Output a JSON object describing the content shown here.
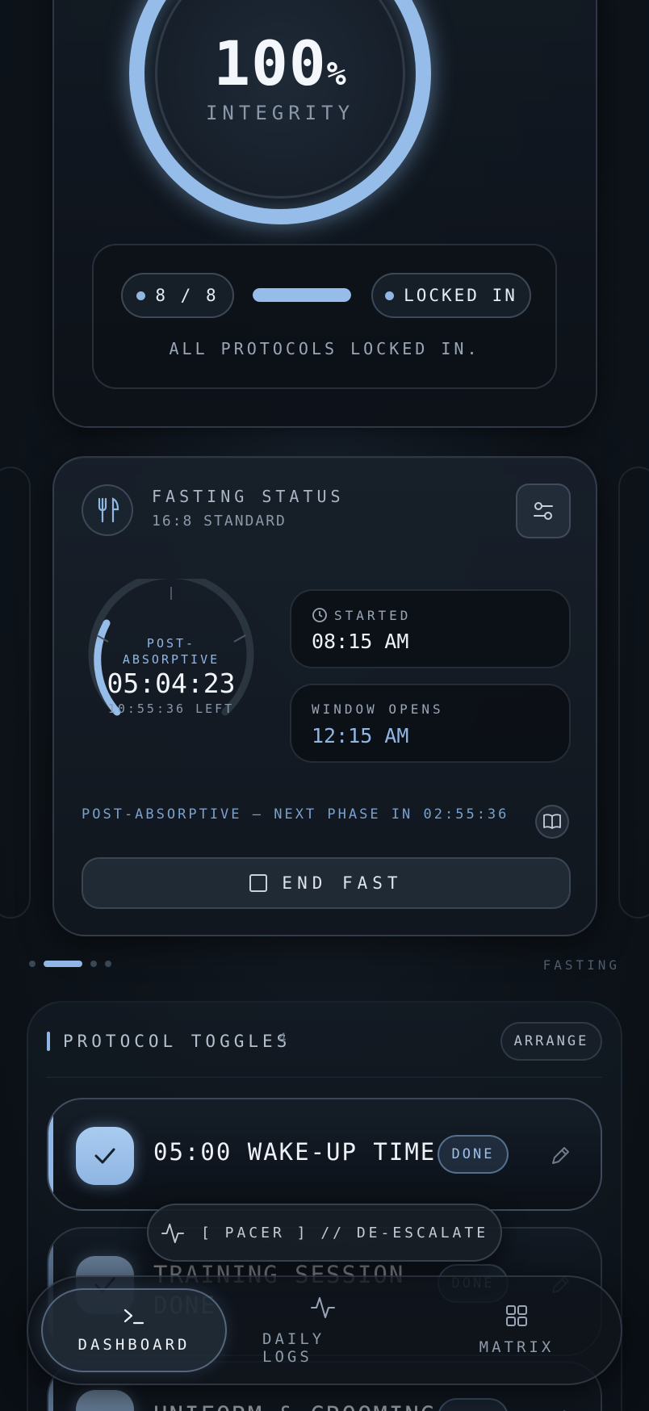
{
  "integrity": {
    "value": "100",
    "unit": "%",
    "label": "INTEGRITY",
    "count": "8 / 8",
    "progress": 1.0,
    "status": "LOCKED IN",
    "message": "ALL PROTOCOLS LOCKED IN."
  },
  "fasting": {
    "title": "FASTING STATUS",
    "subtitle": "16:8 STANDARD",
    "phase": "POST-\nABSORPTIVE",
    "elapsed": "05:04:23",
    "remaining": "10:55:36 LEFT",
    "started_label": "STARTED",
    "started_value": "08:15 AM",
    "window_label": "WINDOW OPENS",
    "window_value": "12:15 AM",
    "phase_info": "POST-ABSORPTIVE — NEXT PHASE IN 02:55:36",
    "end_button": "END FAST"
  },
  "pager": {
    "label": "FASTING"
  },
  "protocols": {
    "title": "PROTOCOL TOGGLES",
    "count": "4",
    "arrange_label": "ARRANGE",
    "items": [
      {
        "label": "05:00 WAKE-UP TIME",
        "status": "DONE"
      },
      {
        "label": "TRAINING SESSION DONE",
        "status": "DONE"
      },
      {
        "label": "UNIFORM & GROOMING",
        "status": "DONE"
      }
    ]
  },
  "pacer": {
    "label": "[ PACER ] // DE-ESCALATE"
  },
  "nav": {
    "dashboard": "DASHBOARD",
    "logs": "DAILY LOGS",
    "matrix": "MATRIX"
  },
  "colors": {
    "accent": "#8fb6e4",
    "background": "#0e141b"
  }
}
